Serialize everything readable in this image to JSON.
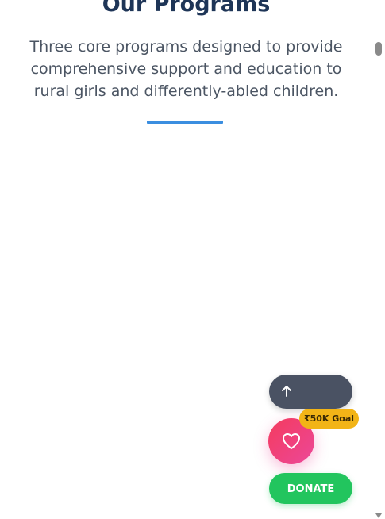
{
  "section": {
    "title": "Our Programs",
    "description": "Three core programs designed to provide comprehensive support and education to rural girls and differently-abled children."
  },
  "floating": {
    "scroll_top_icon": "arrow-up-icon",
    "goal_badge": "₹50K Goal",
    "heart_icon": "heart-icon",
    "donate_label": "DONATE"
  },
  "colors": {
    "title": "#1e3557",
    "accent_divider": "#3b8ee0",
    "scroll_top_bg": "#4a5263",
    "goal_badge_bg": "#f2b417",
    "heart_gradient_start": "#f43b5e",
    "heart_gradient_end": "#ec4899",
    "donate_bg": "#22c55e"
  }
}
